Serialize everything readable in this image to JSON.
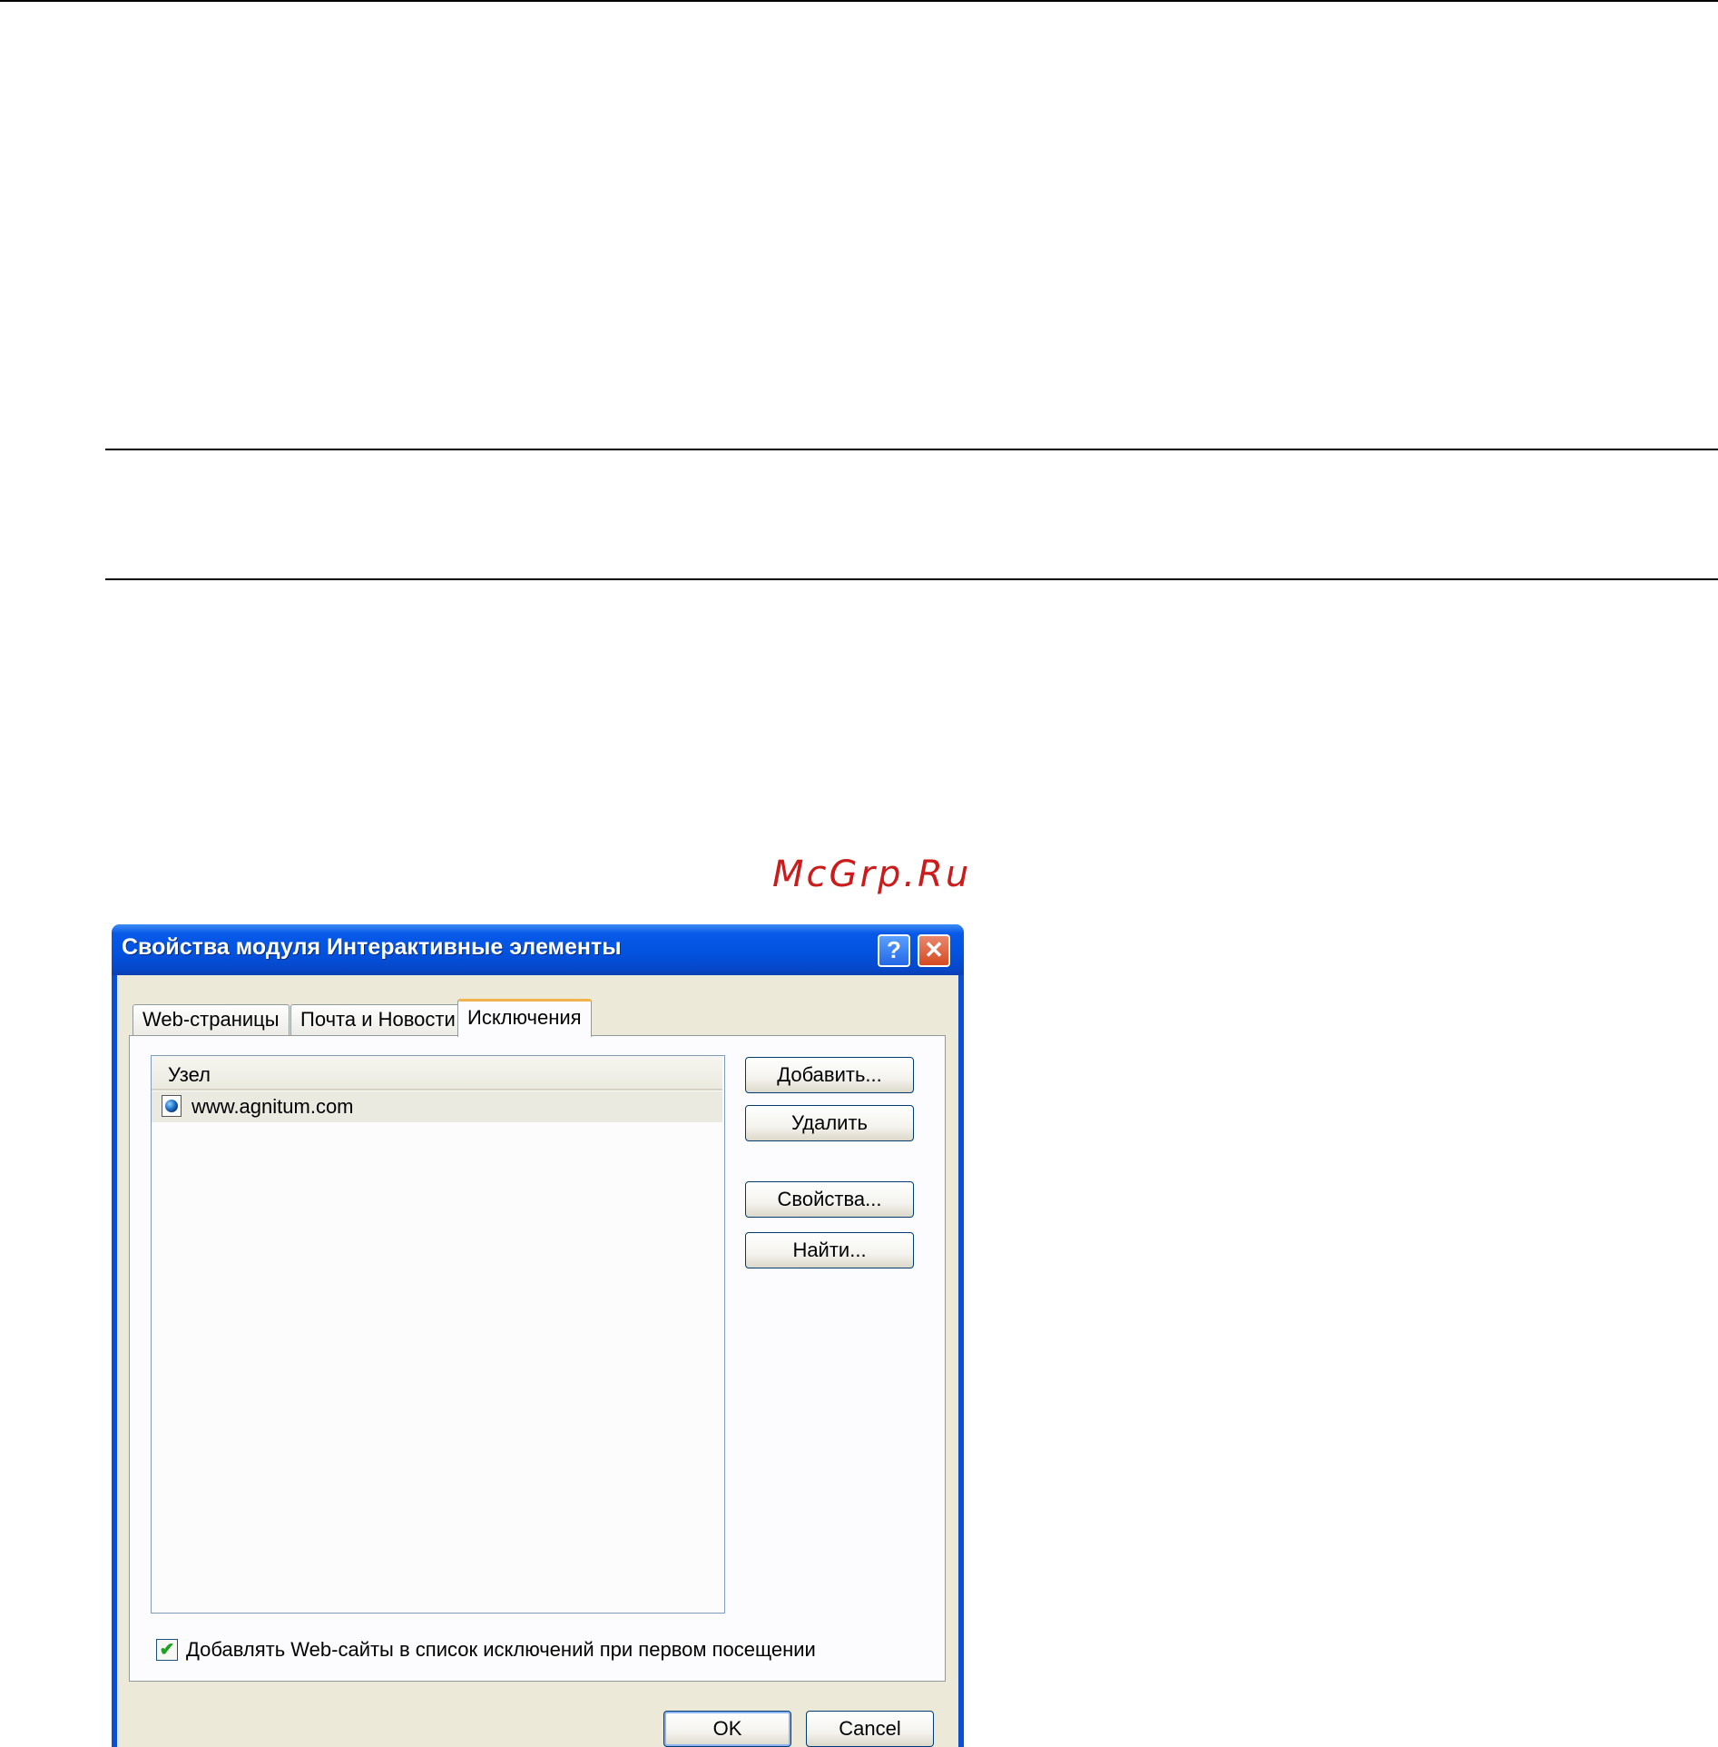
{
  "watermark": "McGrp.Ru",
  "dialog": {
    "title": "Свойства модуля Интерактивные элементы",
    "help_glyph": "?",
    "close_glyph": "✕",
    "tabs": [
      {
        "label": "Web-страницы",
        "active": false
      },
      {
        "label": "Почта и Новости",
        "active": false
      },
      {
        "label": "Исключения",
        "active": true
      }
    ],
    "list": {
      "column_header": "Узел",
      "rows": [
        {
          "icon": "globe-page-icon",
          "text": "www.agnitum.com",
          "selected": true
        }
      ]
    },
    "buttons": {
      "add": "Добавить...",
      "remove": "Удалить",
      "properties": "Свойства...",
      "find": "Найти...",
      "ok": "OK",
      "cancel": "Cancel"
    },
    "checkbox": {
      "checked": true,
      "mark": "✔",
      "label": "Добавлять Web-сайты в список исключений при первом посещении"
    }
  },
  "colors": {
    "titlebar": "#0353e0",
    "window_bg": "#ece9d8",
    "active_tab_accent": "#f3b34c",
    "watermark": "#cc1b1b"
  }
}
